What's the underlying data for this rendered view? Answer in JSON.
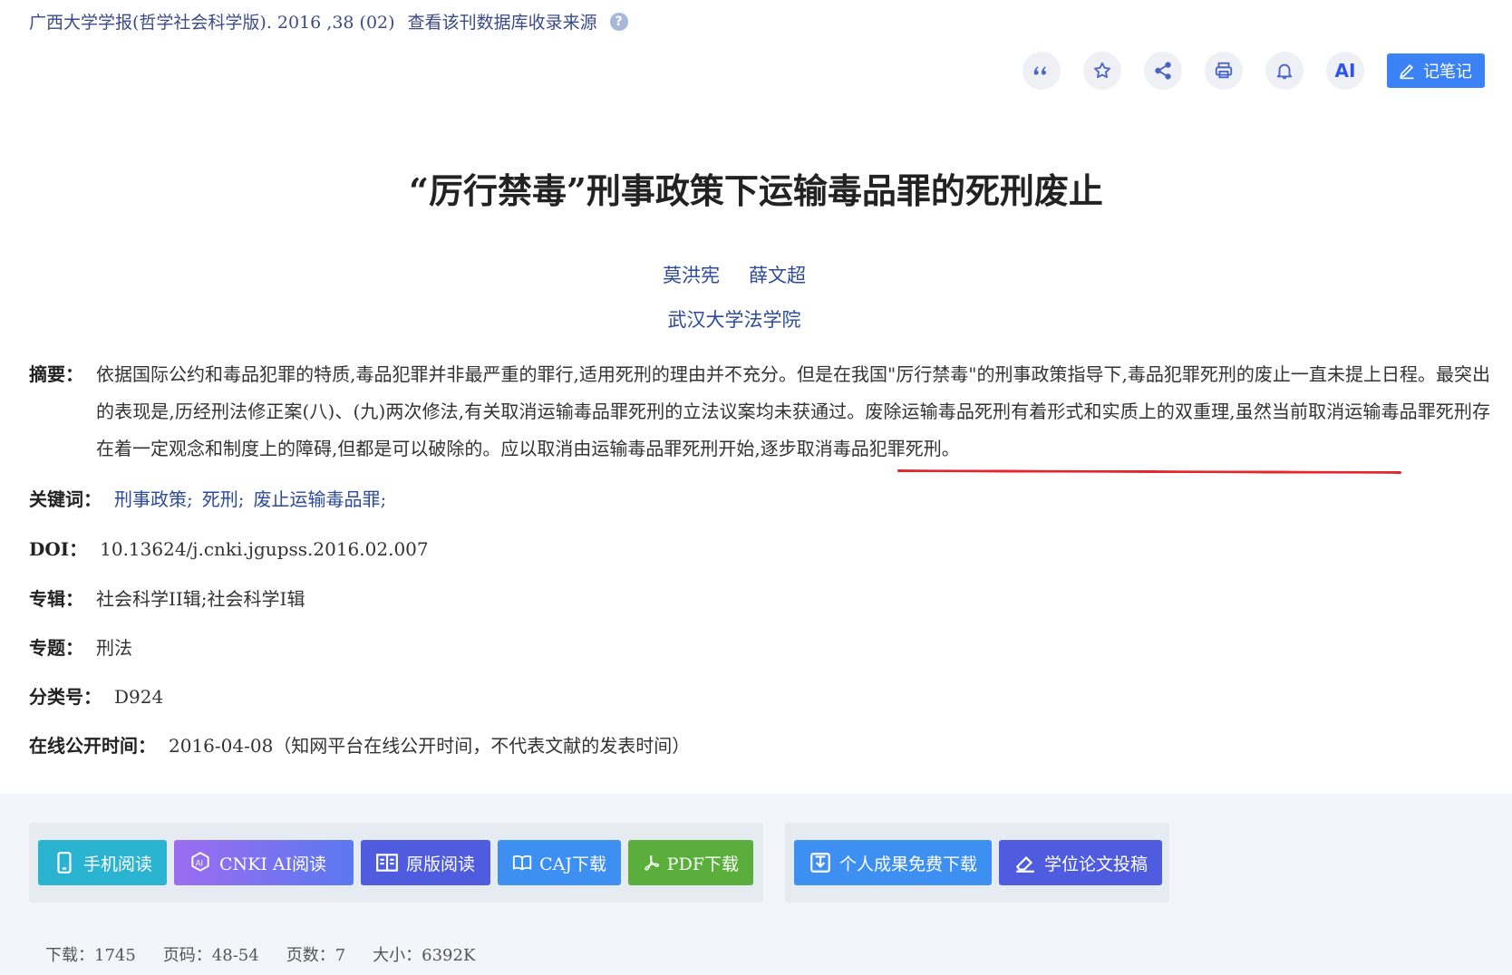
{
  "source": {
    "journal": "广西大学学报(哲学社会科学版)",
    "issue": ". 2016 ,38 (02)",
    "db_link": "查看该刊数据库收录来源",
    "help_glyph": "?"
  },
  "toolbar": {
    "ai_label": "AI",
    "note_label": "记笔记"
  },
  "article": {
    "title": "“厉行禁毒”刑事政策下运输毒品罪的死刑废止",
    "authors": [
      "莫洪宪",
      "薛文超"
    ],
    "affiliation": "武汉大学法学院"
  },
  "abstract": {
    "label": "摘要：",
    "text": "依据国际公约和毒品犯罪的特质,毒品犯罪并非最严重的罪行,适用死刑的理由并不充分。但是在我国\"厉行禁毒\"的刑事政策指导下,毒品犯罪死刑的废止一直未提上日程。最突出的表现是,历经刑法修正案(八)、(九)两次修法,有关取消运输毒品罪死刑的立法议案均未获通过。废除运输毒品死刑有着形式和实质上的双重理,虽然当前取消运输毒品罪死刑存在着一定观念和制度上的障碍,但都是可以破除的。应以取消由运输毒品罪死刑开始,逐步取消毒品犯罪死刑。"
  },
  "meta": {
    "keywords_label": "关键词：",
    "keywords": [
      "刑事政策;",
      "死刑;",
      "废止运输毒品罪;"
    ],
    "doi_label": "DOI：",
    "doi": "10.13624/j.cnki.jgupss.2016.02.007",
    "series_label": "专辑：",
    "series": "社会科学II辑;社会科学I辑",
    "topic_label": "专题：",
    "topic": "刑法",
    "class_label": "分类号：",
    "class": "D924",
    "online_label": "在线公开时间：",
    "online": "2016-04-08（知网平台在线公开时间，不代表文献的发表时间）"
  },
  "actions": {
    "mobile": "手机阅读",
    "cnki_ai": "CNKI AI阅读",
    "original": "原版阅读",
    "caj": "CAJ下载",
    "pdf": "PDF下载",
    "personal": "个人成果免费下载",
    "thesis": "学位论文投稿"
  },
  "stats": {
    "downloads": "下载：1745",
    "pages_range": "页码：48-54",
    "page_count": "页数：7",
    "size": "大小：6392K"
  },
  "colors": {
    "mobile": "#2bb3d2",
    "cnki_ai": "#8b6cf0",
    "original": "#4f5ce0",
    "caj": "#3d8ff2",
    "pdf": "#5aaf3c",
    "personal": "#3d8ff2",
    "thesis": "#4f5ce0"
  }
}
